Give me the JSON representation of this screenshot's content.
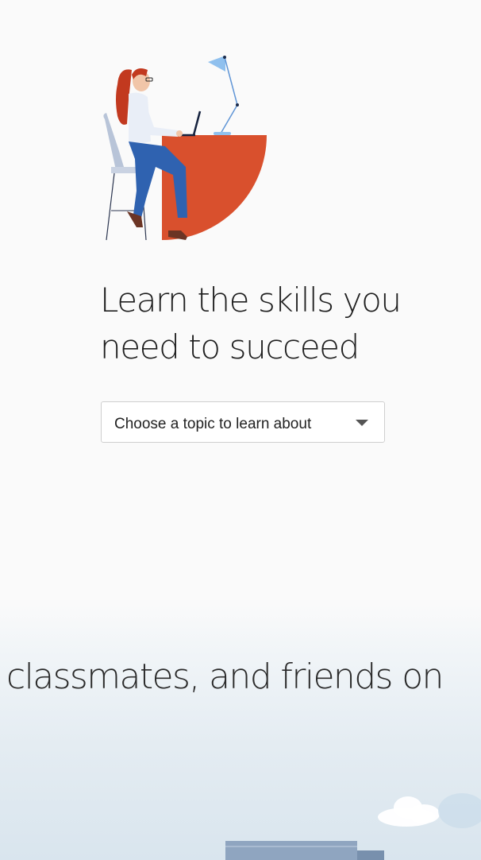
{
  "hero": {
    "headline_line1": "Learn the skills you",
    "headline_line2": "need to succeed",
    "illustration": "person-at-desk-illustration"
  },
  "topic_select": {
    "selected_label": "Choose a topic to learn about",
    "icon": "caret-down-icon"
  },
  "footer_banner": {
    "text": "classmates, and friends on"
  },
  "colors": {
    "background": "#fafafa",
    "accent_orange": "#d9502d",
    "lamp_blue": "#7fb2e8",
    "pants_blue": "#2f62b0",
    "sky_blue": "#d9e5ee"
  }
}
